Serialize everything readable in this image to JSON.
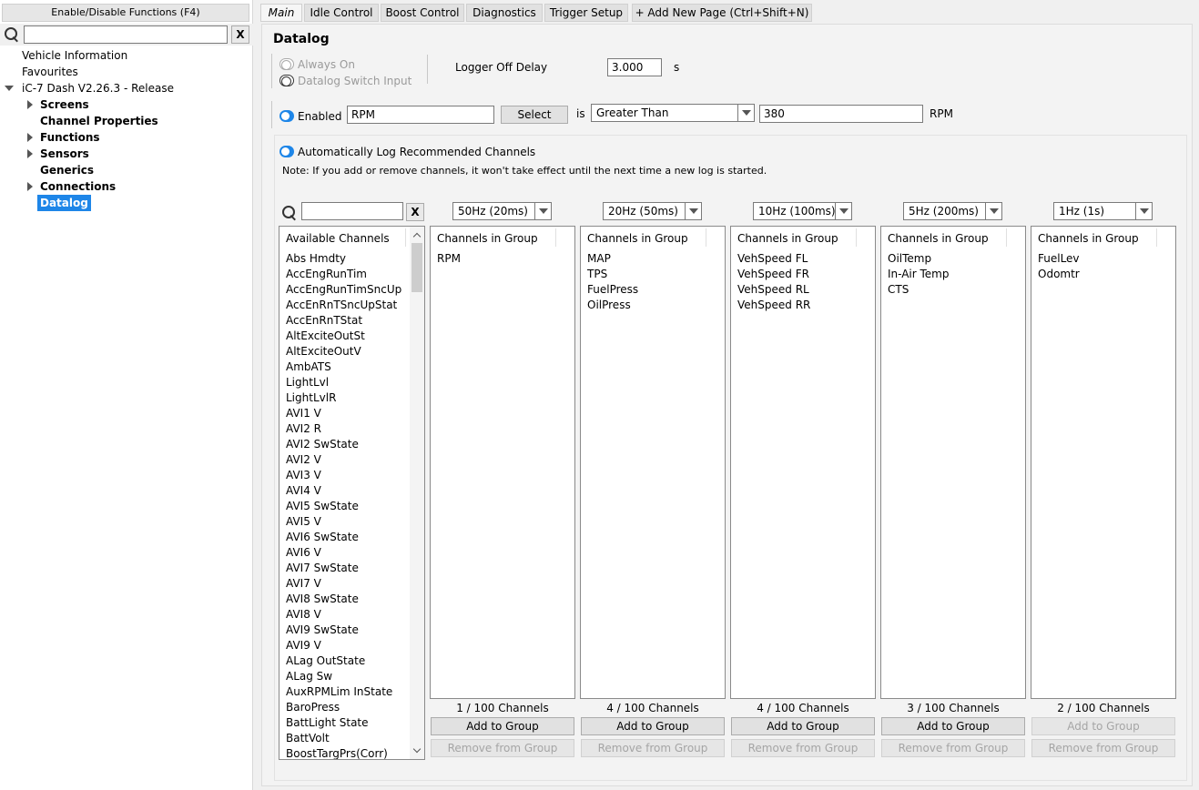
{
  "sidebar": {
    "enable_button": "Enable/Disable Functions (F4)",
    "search": {
      "value": "",
      "clear_label": "X"
    },
    "tree": [
      {
        "label": "Vehicle Information"
      },
      {
        "label": "Favourites"
      },
      {
        "label": "iC-7 Dash V2.26.3 - Release"
      },
      {
        "label": "Screens"
      },
      {
        "label": "Channel Properties"
      },
      {
        "label": "Functions"
      },
      {
        "label": "Sensors"
      },
      {
        "label": "Generics"
      },
      {
        "label": "Connections"
      },
      {
        "label": "Datalog"
      }
    ]
  },
  "tabs": [
    "Main",
    "Idle Control",
    "Boost Control",
    "Diagnostics",
    "Trigger Setup",
    "+ Add New Page (Ctrl+Shift+N)"
  ],
  "page": {
    "title": "Datalog",
    "always_on": "Always On",
    "switch_input": "Datalog Switch Input",
    "logger_off_delay_label": "Logger Off Delay",
    "logger_off_delay_value": "3.000",
    "logger_off_delay_unit": "s",
    "enabled_label": "Enabled",
    "condition_channel": "RPM",
    "select_button": "Select",
    "is_label": "is",
    "comparison": "Greater Than",
    "threshold": "380",
    "threshold_unit": "RPM",
    "auto_log_label": "Automatically Log Recommended Channels",
    "note": "Note: If you add or remove channels, it won't take effect until the next time a new log is started."
  },
  "channels": {
    "search_value": "",
    "clear_label": "X",
    "header": "Available Channels",
    "items": [
      "Abs Hmdty",
      "AccEngRunTim",
      "AccEngRunTimSncUp",
      "AccEnRnTSncUpStat",
      "AccEnRnTStat",
      "AltExciteOutSt",
      "AltExciteOutV",
      "AmbATS",
      "LightLvl",
      "LightLvlR",
      "AVI1 V",
      "AVI2 R",
      "AVI2 SwState",
      "AVI2 V",
      "AVI3 V",
      "AVI4 V",
      "AVI5 SwState",
      "AVI5 V",
      "AVI6 SwState",
      "AVI6 V",
      "AVI7 SwState",
      "AVI7 V",
      "AVI8 SwState",
      "AVI8 V",
      "AVI9 SwState",
      "AVI9 V",
      "ALag OutState",
      "ALag Sw",
      "AuxRPMLim InState",
      "BaroPress",
      "BattLight State",
      "BattVolt",
      "BoostTargPrs(Corr)"
    ]
  },
  "groups": [
    {
      "rate": "50Hz (20ms)",
      "header": "Channels in Group",
      "items": [
        "RPM"
      ],
      "count": "1 / 100 Channels",
      "add": "Add to Group",
      "remove": "Remove from Group"
    },
    {
      "rate": "20Hz (50ms)",
      "header": "Channels in Group",
      "items": [
        "MAP",
        "TPS",
        "FuelPress",
        "OilPress"
      ],
      "count": "4 / 100 Channels",
      "add": "Add to Group",
      "remove": "Remove from Group"
    },
    {
      "rate": "10Hz (100ms)",
      "header": "Channels in Group",
      "items": [
        "VehSpeed FL",
        "VehSpeed FR",
        "VehSpeed RL",
        "VehSpeed RR"
      ],
      "count": "4 / 100 Channels",
      "add": "Add to Group",
      "remove": "Remove from Group"
    },
    {
      "rate": "5Hz (200ms)",
      "header": "Channels in Group",
      "items": [
        "OilTemp",
        "In-Air Temp",
        "CTS"
      ],
      "count": "3 / 100 Channels",
      "add": "Add to Group",
      "remove": "Remove from Group"
    },
    {
      "rate": "1Hz (1s)",
      "header": "Channels in Group",
      "items": [
        "FuelLev",
        "Odomtr"
      ],
      "count": "2 / 100 Channels",
      "add": "Add to Group",
      "remove": "Remove from Group"
    }
  ],
  "colors": {
    "accent": "#1e86e8"
  }
}
